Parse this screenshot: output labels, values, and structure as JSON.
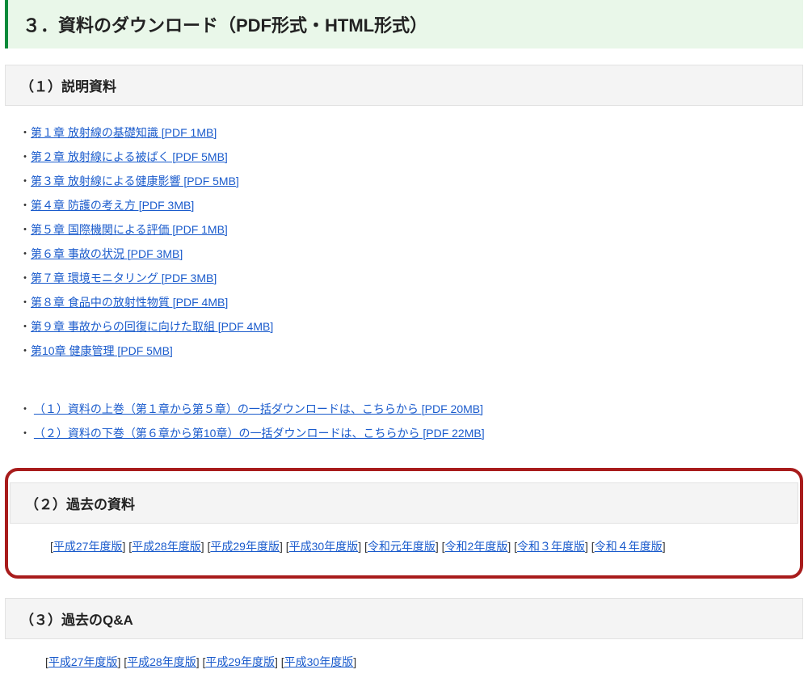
{
  "main_heading": "３．資料のダウンロード（PDF形式・HTML形式）",
  "section1": {
    "heading": "（１）説明資料",
    "chapters": [
      "第１章 放射線の基礎知識 [PDF 1MB]",
      "第２章 放射線による被ばく [PDF 5MB]",
      "第３章 放射線による健康影響 [PDF 5MB]",
      "第４章 防護の考え方 [PDF 3MB]",
      "第５章 国際機関による評価 [PDF 1MB]",
      "第６章 事故の状況 [PDF 3MB]",
      "第７章 環境モニタリング [PDF 3MB]",
      "第８章 食品中の放射性物質 [PDF 4MB]",
      "第９章 事故からの回復に向けた取組 [PDF 4MB]",
      "第10章 健康管理 [PDF 5MB]"
    ],
    "bulk": [
      "（１）資料の上巻（第１章から第５章）の一括ダウンロードは、こちらから [PDF 20MB]",
      "（２）資料の下巻（第６章から第10章）の一括ダウンロードは、こちらから [PDF 22MB]"
    ]
  },
  "section2": {
    "heading": "（２）過去の資料",
    "versions": [
      "平成27年度版",
      "平成28年度版",
      "平成29年度版",
      "平成30年度版",
      "令和元年度版",
      "令和2年度版",
      "令和３年度版",
      "令和４年度版"
    ]
  },
  "section3": {
    "heading": "（３）過去のQ&A",
    "versions": [
      "平成27年度版",
      "平成28年度版",
      "平成29年度版",
      "平成30年度版"
    ]
  }
}
